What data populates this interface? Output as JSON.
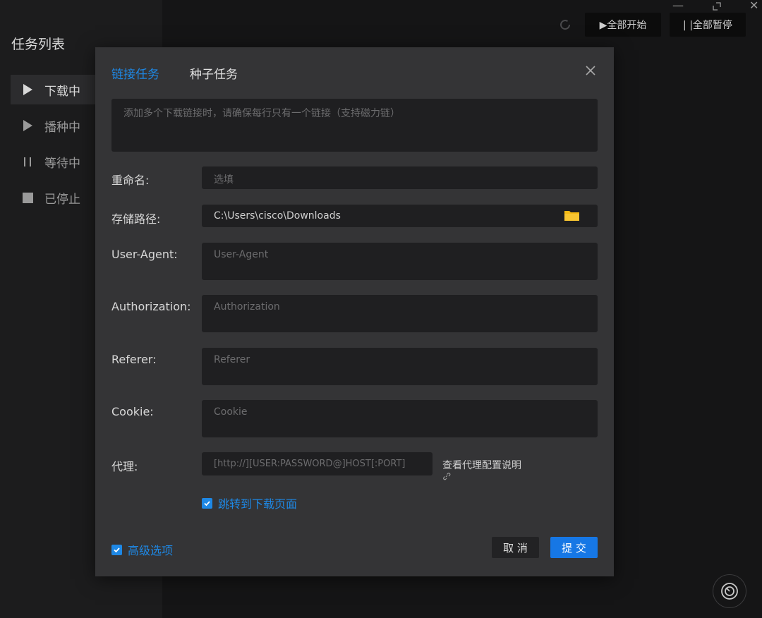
{
  "sidebar": {
    "title": "任务列表",
    "items": [
      {
        "label": "下载中",
        "icon": "play-icon"
      },
      {
        "label": "播种中",
        "icon": "play-icon"
      },
      {
        "label": "等待中",
        "icon": "pause-icon"
      },
      {
        "label": "已停止",
        "icon": "stop-icon"
      }
    ]
  },
  "toolbar": {
    "start_all": "▶全部开始",
    "pause_all": "| |全部暂停"
  },
  "dialog": {
    "tabs": [
      "链接任务",
      "种子任务"
    ],
    "links_placeholder": "添加多个下载链接时，请确保每行只有一个链接（支持磁力链）",
    "rename_label": "重命名:",
    "rename_placeholder": "选填",
    "path_label": "存储路径:",
    "path_value": "C:\\Users\\cisco\\Downloads",
    "ua_label": "User-Agent:",
    "ua_placeholder": "User-Agent",
    "auth_label": "Authorization:",
    "auth_placeholder": "Authorization",
    "referer_label": "Referer:",
    "referer_placeholder": "Referer",
    "cookie_label": "Cookie:",
    "cookie_placeholder": "Cookie",
    "proxy_label": "代理:",
    "proxy_placeholder": "[http://][USER:PASSWORD@]HOST[:PORT]",
    "proxy_help": "查看代理配置说明",
    "jump_label": "跳转到下载页面",
    "advanced_label": "高级选项",
    "cancel": "取 消",
    "submit": "提 交"
  },
  "colors": {
    "accent": "#1e88e5",
    "submit": "#1677e5",
    "folder": "#f5b914"
  }
}
